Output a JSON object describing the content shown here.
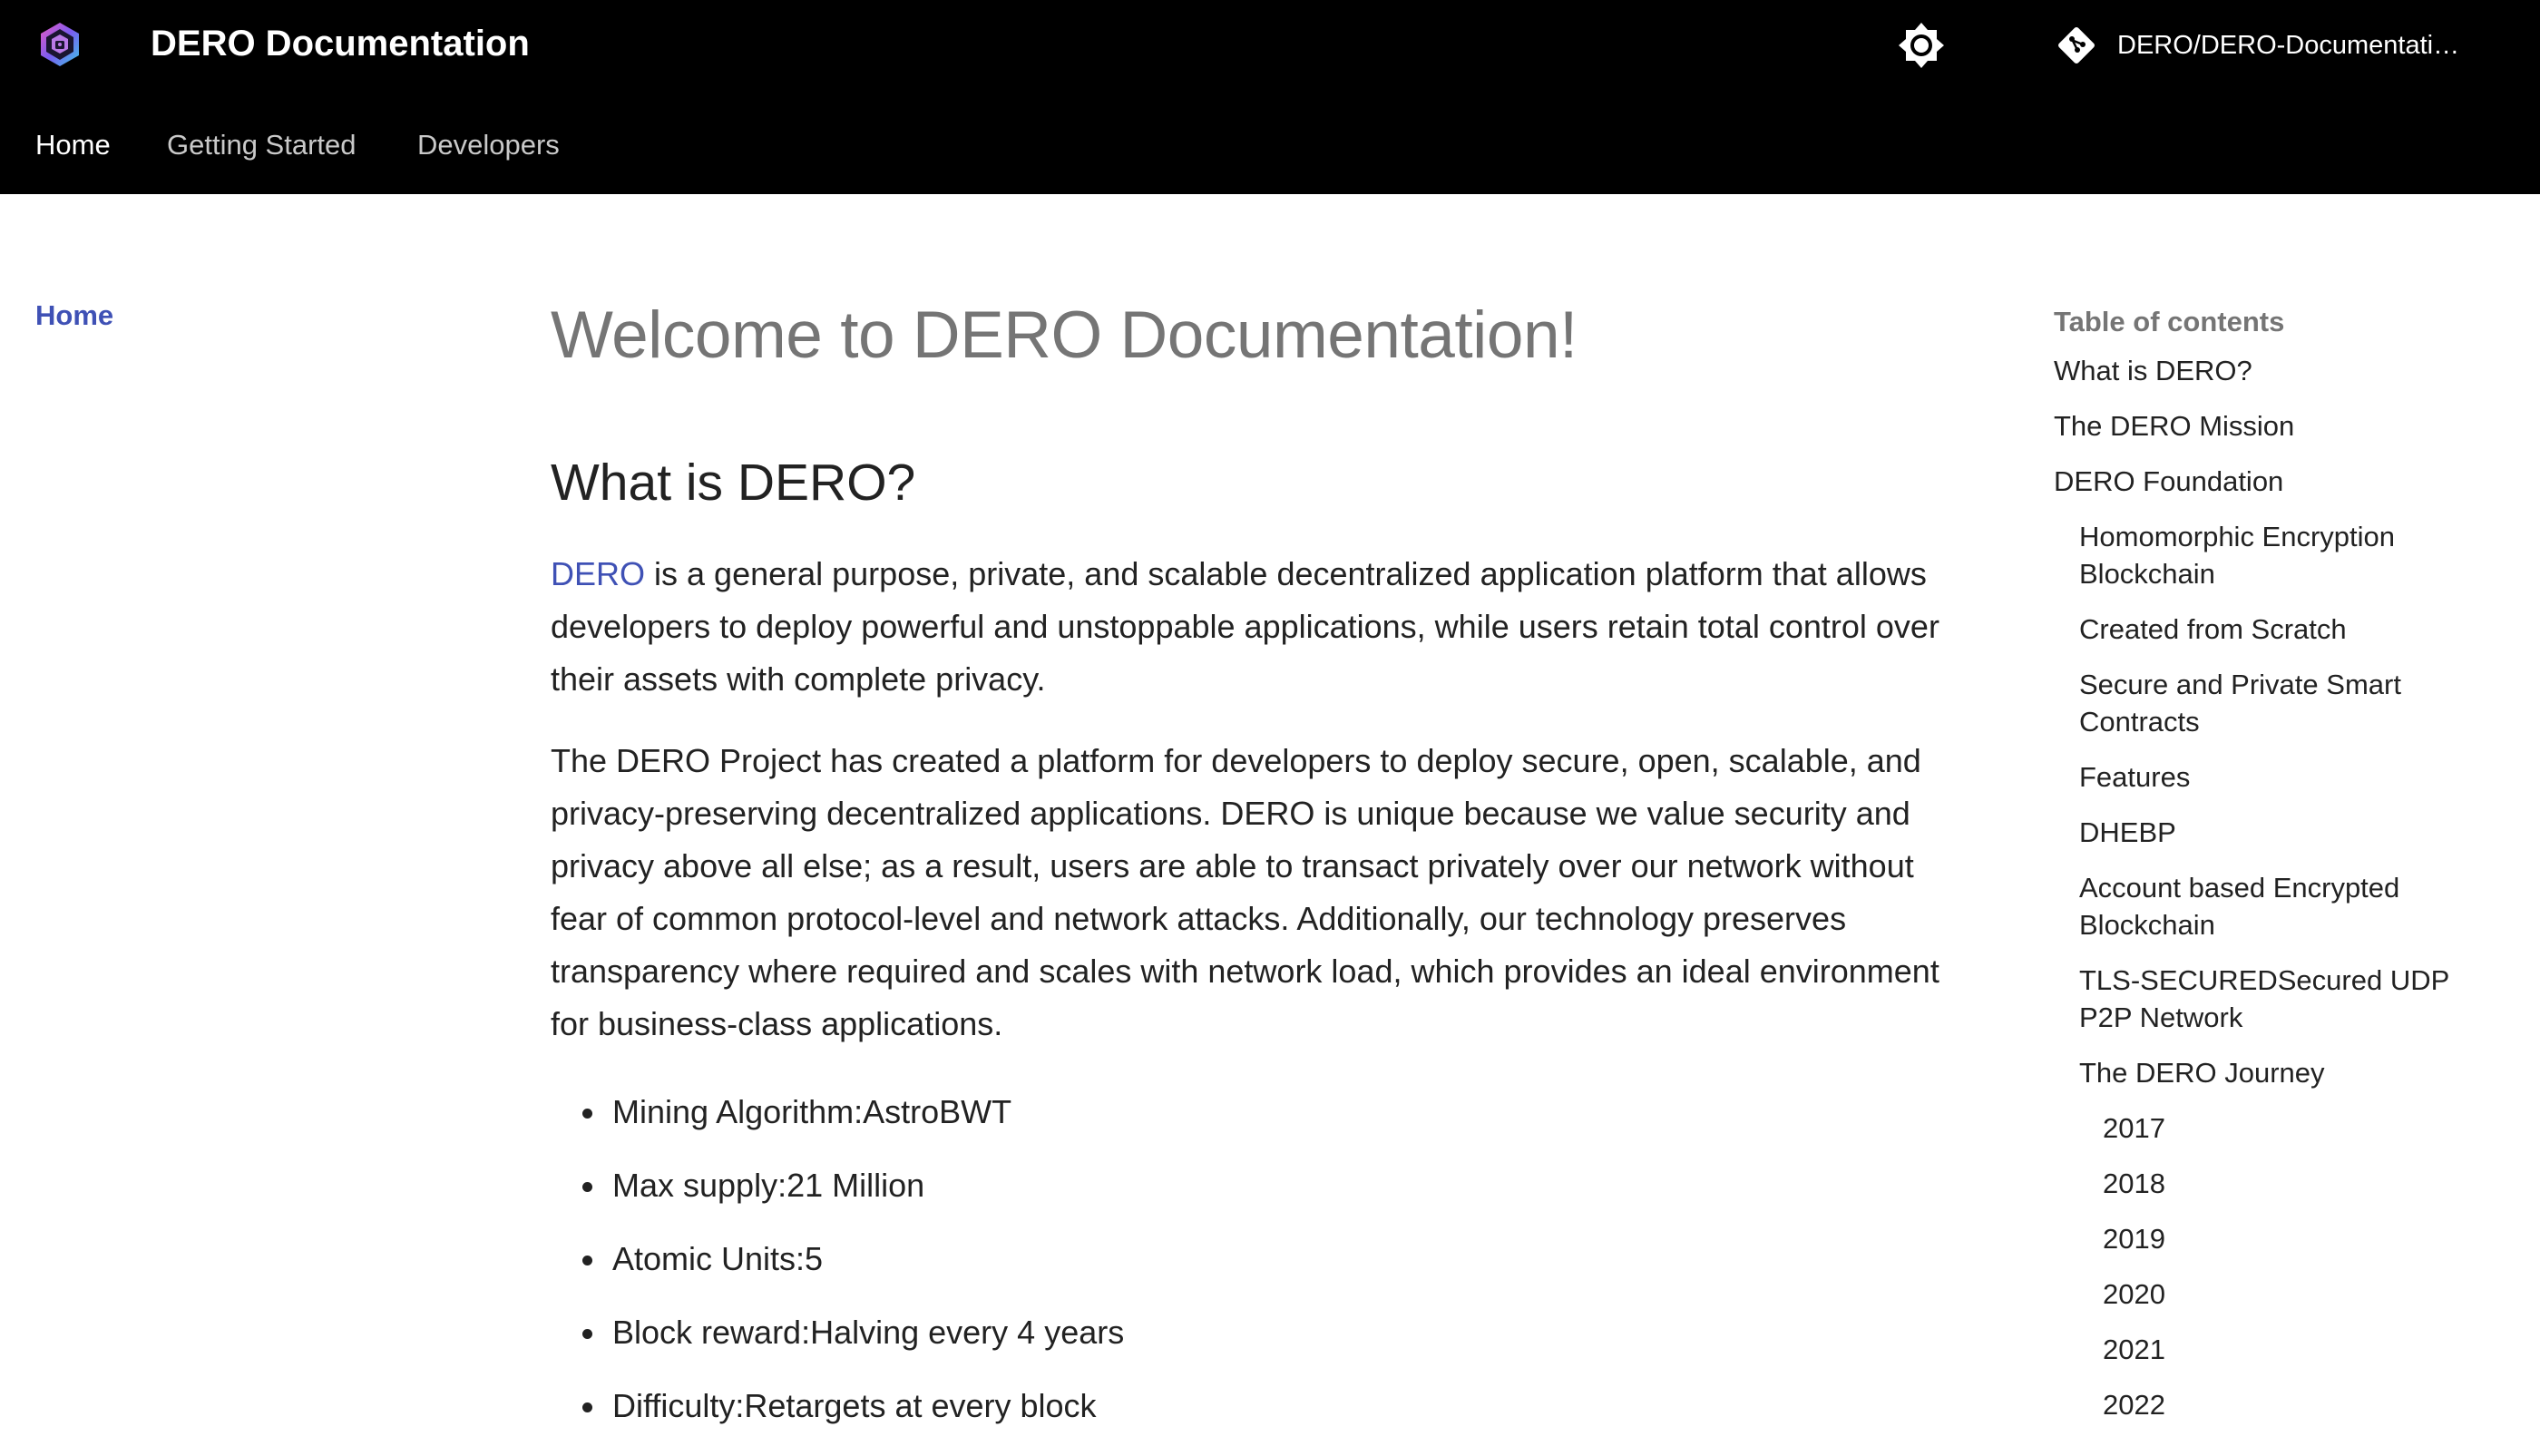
{
  "header": {
    "site_title": "DERO Documentation",
    "repo_label": "DERO/DERO-Documentati…",
    "logo_icon": "dero-logo-icon",
    "theme_icon": "brightness-icon",
    "repo_icon": "git-icon",
    "tabs": [
      {
        "label": "Home",
        "active": true
      },
      {
        "label": "Getting Started",
        "active": false
      },
      {
        "label": "Developers",
        "active": false
      }
    ]
  },
  "left_nav": {
    "home_label": "Home"
  },
  "main": {
    "title": "Welcome to DERO Documentation!",
    "section_heading": "What is DERO?",
    "intro_link": "DERO",
    "intro_rest": " is a general purpose, private, and scalable decentralized application platform that allows developers to deploy powerful and unstoppable applications, while users retain total control over their assets with complete privacy.",
    "paragraph2": "The DERO Project has created a platform for developers to deploy secure, open, scalable, and privacy-preserving decentralized applications. DERO is unique because we value security and privacy above all else; as a result, users are able to transact privately over our network without fear of common protocol-level and network attacks. Additionally, our technology preserves transparency where required and scales with network load, which provides an ideal environment for business-class applications.",
    "facts": [
      "Mining Algorithm:AstroBWT",
      "Max supply:21 Million",
      "Atomic Units:5",
      "Block reward:Halving every 4 years",
      "Difficulty:Retargets at every block"
    ]
  },
  "toc": {
    "title": "Table of contents",
    "items": [
      {
        "label": "What is DERO?",
        "level": 1
      },
      {
        "label": "The DERO Mission",
        "level": 1
      },
      {
        "label": "DERO Foundation",
        "level": 1
      },
      {
        "label": "Homomorphic Encryption Blockchain",
        "level": 2
      },
      {
        "label": "Created from Scratch",
        "level": 2
      },
      {
        "label": "Secure and Private Smart Contracts",
        "level": 2
      },
      {
        "label": "Features",
        "level": 2
      },
      {
        "label": "DHEBP",
        "level": 2
      },
      {
        "label": "Account based Encrypted Blockchain",
        "level": 2
      },
      {
        "label": "TLS-SECUREDSecured UDP P2P Network",
        "level": 2
      },
      {
        "label": "The DERO Journey",
        "level": 2
      },
      {
        "label": "2017",
        "level": 3
      },
      {
        "label": "2018",
        "level": 3
      },
      {
        "label": "2019",
        "level": 3
      },
      {
        "label": "2020",
        "level": 3
      },
      {
        "label": "2021",
        "level": 3
      },
      {
        "label": "2022",
        "level": 3
      }
    ]
  },
  "colors": {
    "header_bg": "#000000",
    "accent": "#3f51b5",
    "title_grey": "#757575"
  }
}
